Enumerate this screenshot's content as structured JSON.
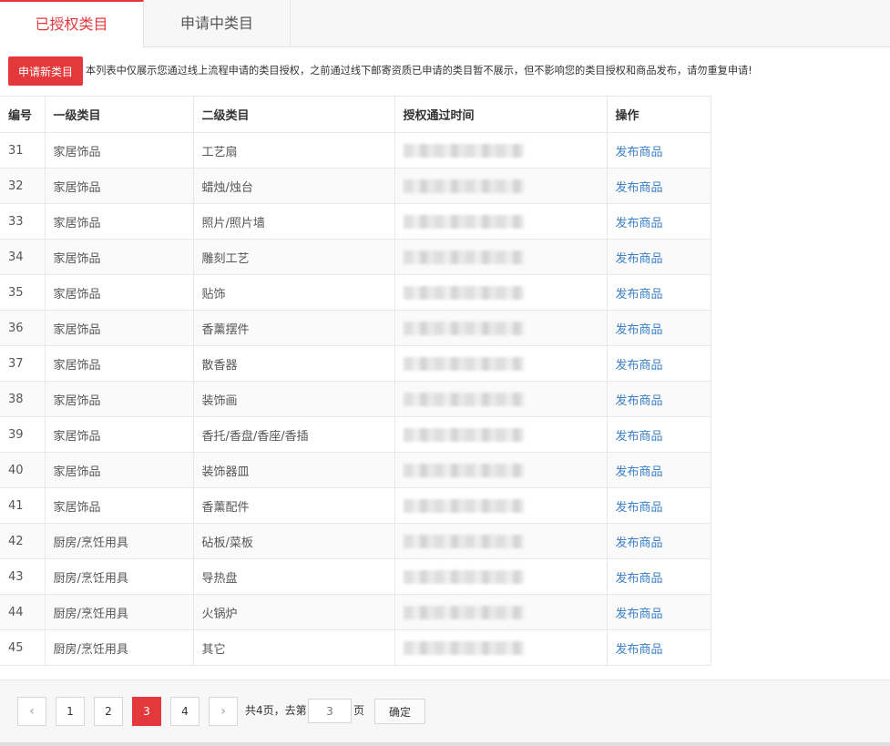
{
  "tabs": [
    {
      "label": "已授权类目",
      "active": true
    },
    {
      "label": "申请中类目",
      "active": false
    }
  ],
  "actions": {
    "apply_label": "申请新类目",
    "notice": "本列表中仅展示您通过线上流程申请的类目授权，之前通过线下邮寄资质已申请的类目暂不展示，但不影响您的类目授权和商品发布，请勿重复申请!"
  },
  "table": {
    "headers": [
      "编号",
      "一级类目",
      "二级类目",
      "授权通过时间",
      "操作"
    ],
    "action_label": "发布商品",
    "rows": [
      {
        "id": "31",
        "cat1": "家居饰品",
        "cat2": "工艺扇"
      },
      {
        "id": "32",
        "cat1": "家居饰品",
        "cat2": "蜡烛/烛台"
      },
      {
        "id": "33",
        "cat1": "家居饰品",
        "cat2": "照片/照片墙"
      },
      {
        "id": "34",
        "cat1": "家居饰品",
        "cat2": "雕刻工艺"
      },
      {
        "id": "35",
        "cat1": "家居饰品",
        "cat2": "贴饰"
      },
      {
        "id": "36",
        "cat1": "家居饰品",
        "cat2": "香薰摆件"
      },
      {
        "id": "37",
        "cat1": "家居饰品",
        "cat2": "散香器"
      },
      {
        "id": "38",
        "cat1": "家居饰品",
        "cat2": "装饰画"
      },
      {
        "id": "39",
        "cat1": "家居饰品",
        "cat2": "香托/香盘/香座/香插"
      },
      {
        "id": "40",
        "cat1": "家居饰品",
        "cat2": "装饰器皿"
      },
      {
        "id": "41",
        "cat1": "家居饰品",
        "cat2": "香薰配件"
      },
      {
        "id": "42",
        "cat1": "厨房/烹饪用具",
        "cat2": "砧板/菜板"
      },
      {
        "id": "43",
        "cat1": "厨房/烹饪用具",
        "cat2": "导热盘"
      },
      {
        "id": "44",
        "cat1": "厨房/烹饪用具",
        "cat2": "火锅炉"
      },
      {
        "id": "45",
        "cat1": "厨房/烹饪用具",
        "cat2": "其它"
      }
    ]
  },
  "pagination": {
    "prev_icon": "‹",
    "next_icon": "›",
    "pages": [
      "1",
      "2",
      "3",
      "4"
    ],
    "current": "3",
    "total_text": "共4页，去第",
    "page_suffix": "页",
    "input_placeholder": "3",
    "go_label": "确定"
  },
  "colors": {
    "accent": "#e4393c",
    "link": "#3a7fc6"
  }
}
